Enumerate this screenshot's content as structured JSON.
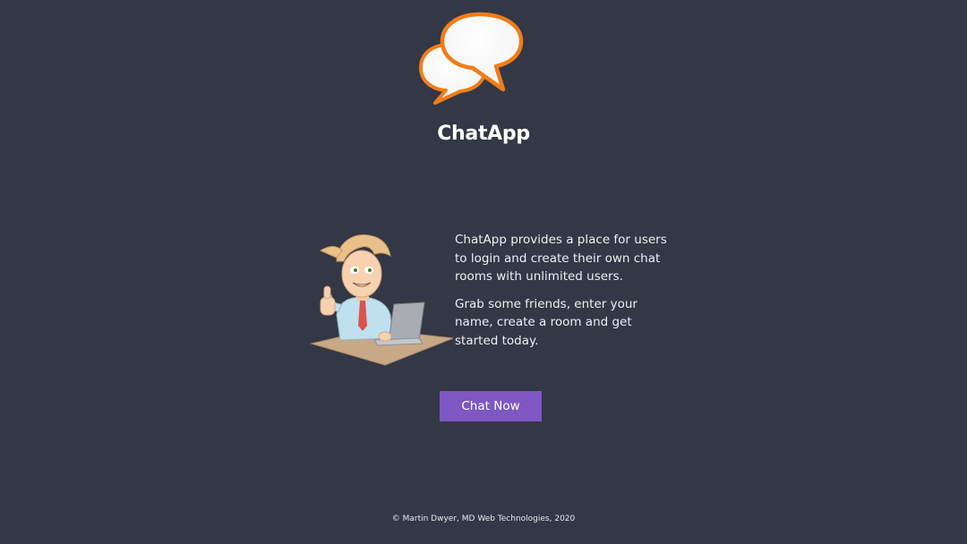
{
  "app": {
    "title": "ChatApp",
    "logo_icon": "speech-bubbles-icon",
    "accent_color": "#f07d1a"
  },
  "intro": {
    "illustration": "developer-thumbs-up-illustration",
    "paragraphs": [
      "ChatApp provides a place for users to login and create their own chat rooms with unlimited users.",
      "Grab some friends, enter your name, create a room and get started today."
    ]
  },
  "cta": {
    "label": "Chat Now",
    "color": "#7e57c2"
  },
  "footer": {
    "text": "© Martin Dwyer, MD Web Technologies, 2020"
  },
  "colors": {
    "background": "#343745"
  }
}
